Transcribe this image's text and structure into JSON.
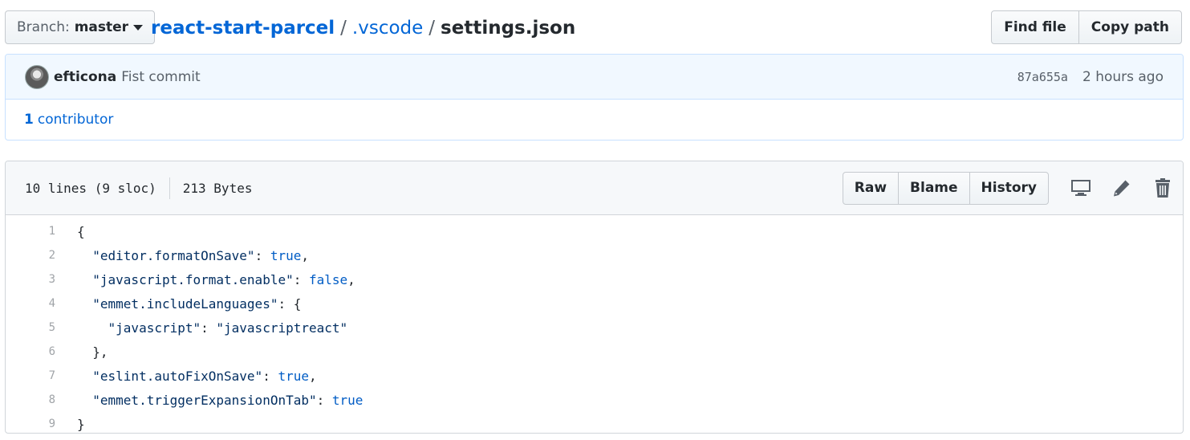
{
  "branch": {
    "label": "Branch:",
    "value": "master"
  },
  "breadcrumb": {
    "repo": "react-start-parcel",
    "separator": "/",
    "folder": ".vscode",
    "file": "settings.json"
  },
  "top_buttons": {
    "find_file": "Find file",
    "copy_path": "Copy path"
  },
  "commit": {
    "author": "efticona",
    "message": "Fist commit",
    "sha": "87a655a",
    "time": "2 hours ago"
  },
  "contributors": {
    "count": "1",
    "label": "contributor"
  },
  "file": {
    "lines_info": "10 lines (9 sloc)",
    "size": "213 Bytes",
    "buttons": {
      "raw": "Raw",
      "blame": "Blame",
      "history": "History"
    },
    "icons": [
      "desktop-icon",
      "pencil-icon",
      "trash-icon"
    ]
  },
  "code_lines": [
    {
      "num": "1",
      "text": "{"
    },
    {
      "num": "2",
      "text": "  \"editor.formatOnSave\": true,"
    },
    {
      "num": "3",
      "text": "  \"javascript.format.enable\": false,"
    },
    {
      "num": "4",
      "text": "  \"emmet.includeLanguages\": {"
    },
    {
      "num": "5",
      "text": "    \"javascript\": \"javascriptreact\""
    },
    {
      "num": "6",
      "text": "  },"
    },
    {
      "num": "7",
      "text": "  \"eslint.autoFixOnSave\": true,"
    },
    {
      "num": "8",
      "text": "  \"emmet.triggerExpansionOnTab\": true"
    },
    {
      "num": "9",
      "text": "}"
    }
  ],
  "colors": {
    "link": "#0366d6",
    "string": "#032f62",
    "keyword": "#005cc5",
    "commit_bg": "#f1f8ff"
  }
}
